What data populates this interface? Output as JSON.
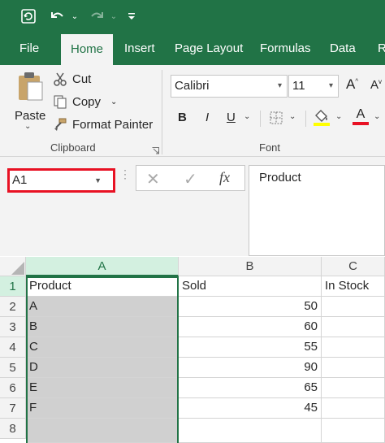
{
  "tabs": [
    "File",
    "Home",
    "Insert",
    "Page Layout",
    "Formulas",
    "Data",
    "R"
  ],
  "clipboard": {
    "paste": "Paste",
    "cut": "Cut",
    "copy": "Copy",
    "format_painter": "Format Painter",
    "group_label": "Clipboard"
  },
  "font": {
    "name": "Calibri",
    "size": "11",
    "group_label": "Font",
    "bold": "B",
    "italic": "I",
    "underline": "U",
    "grow": "A",
    "shrink": "A",
    "font_color": "#e81123",
    "highlight_color": "#ffff00"
  },
  "formula_bar": {
    "name_box": "A1",
    "fx": "fx",
    "content": "Product"
  },
  "columns": [
    "A",
    "B",
    "C"
  ],
  "rows": [
    {
      "num": "1",
      "a": "Product",
      "b": "Sold",
      "c": "In Stock"
    },
    {
      "num": "2",
      "a": "A",
      "b": "50",
      "c": ""
    },
    {
      "num": "3",
      "a": "B",
      "b": "60",
      "c": ""
    },
    {
      "num": "4",
      "a": "C",
      "b": "55",
      "c": ""
    },
    {
      "num": "5",
      "a": "D",
      "b": "90",
      "c": ""
    },
    {
      "num": "6",
      "a": "E",
      "b": "65",
      "c": ""
    },
    {
      "num": "7",
      "a": "F",
      "b": "45",
      "c": ""
    },
    {
      "num": "8",
      "a": "",
      "b": "",
      "c": ""
    }
  ],
  "colors": {
    "brand": "#217346",
    "highlight": "#e81123"
  }
}
